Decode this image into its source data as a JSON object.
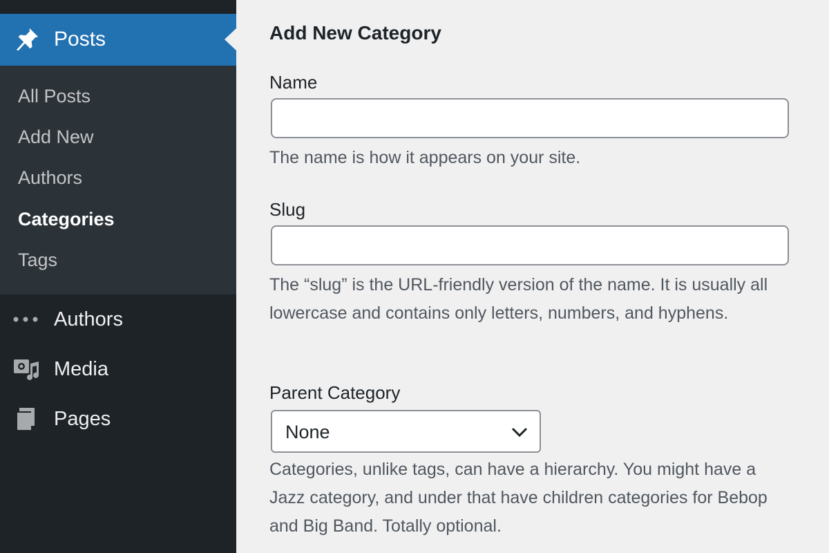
{
  "sidebar": {
    "posts_label": "Posts",
    "submenu": [
      {
        "label": "All Posts",
        "current": false
      },
      {
        "label": "Add New",
        "current": false
      },
      {
        "label": "Authors",
        "current": false
      },
      {
        "label": "Categories",
        "current": true
      },
      {
        "label": "Tags",
        "current": false
      }
    ],
    "menu": [
      {
        "label": "Authors",
        "icon": "ellipsis-icon"
      },
      {
        "label": "Media",
        "icon": "media-icon"
      },
      {
        "label": "Pages",
        "icon": "pages-icon"
      }
    ]
  },
  "form": {
    "title": "Add New Category",
    "name": {
      "label": "Name",
      "value": "",
      "description": "The name is how it appears on your site."
    },
    "slug": {
      "label": "Slug",
      "value": "",
      "description": "The “slug” is the URL-friendly version of the name. It is usually all lowercase and contains only letters, numbers, and hyphens."
    },
    "parent": {
      "label": "Parent Category",
      "selected": "None",
      "description": "Categories, unlike tags, can have a hierarchy. You might have a Jazz category, and under that have children categories for Bebop and Big Band. Totally optional."
    }
  },
  "colors": {
    "sidebar_bg": "#1d2327",
    "submenu_bg": "#2c3338",
    "accent": "#2271b1",
    "page_bg": "#f0f0f1"
  }
}
